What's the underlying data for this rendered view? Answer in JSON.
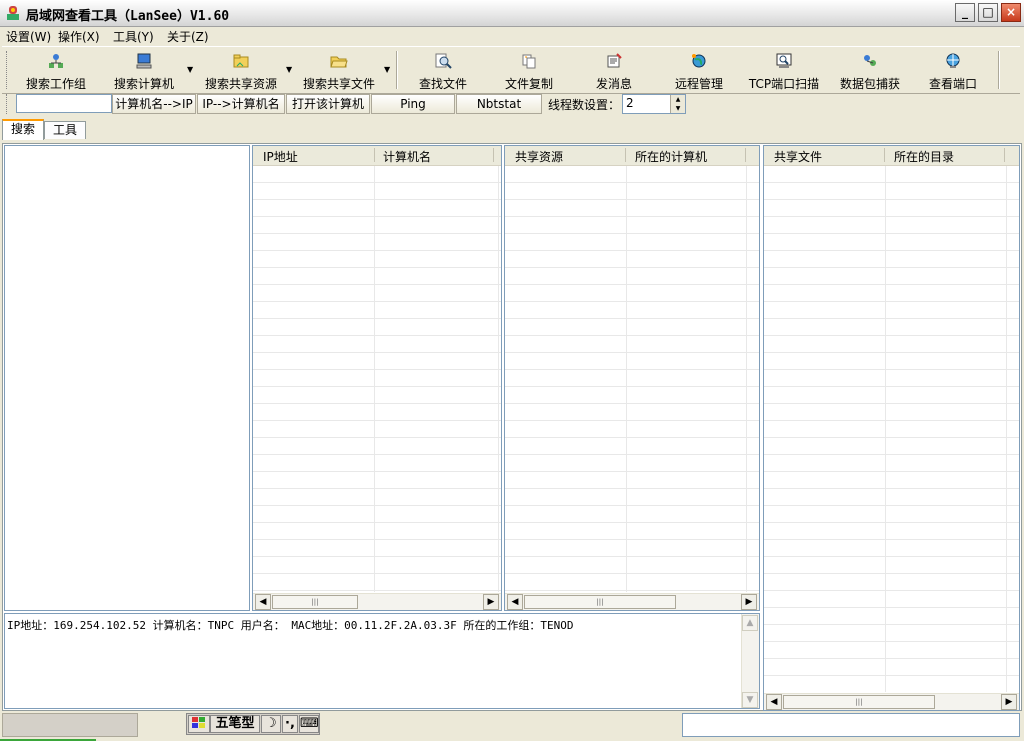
{
  "window": {
    "title": "局域网查看工具（LanSee）V1.60"
  },
  "menu": [
    "设置(W)",
    "操作(X)",
    "工具(Y)",
    "关于(Z)"
  ],
  "toolbar": {
    "items": [
      "搜索工作组",
      "搜索计算机",
      "搜索共享资源",
      "搜索共享文件",
      "查找文件",
      "文件复制",
      "发消息",
      "远程管理",
      "TCP端口扫描",
      "数据包捕获",
      "查看端口"
    ]
  },
  "toolbar2": {
    "input_value": "",
    "buttons": [
      "计算机名-->IP",
      "IP-->计算机名",
      "打开该计算机",
      "Ping",
      "Nbtstat"
    ],
    "thread_label": "线程数设置：",
    "thread_value": "2"
  },
  "tabs": [
    "搜索",
    "工具"
  ],
  "list1": {
    "columns": [
      "IP地址",
      "计算机名"
    ]
  },
  "list2": {
    "columns": [
      "共享资源",
      "所在的计算机"
    ]
  },
  "list3": {
    "columns": [
      "共享文件",
      "所在的目录"
    ]
  },
  "info_text": "IP地址：169.254.102.52 计算机名：TNPC 用户名： MAC地址：00.11.2F.2A.03.3F 所在的工作组：TENOD",
  "ime": {
    "mode": "五笔型"
  },
  "icons": {
    "app": "lansee-app-icon",
    "scroll_left": "◀",
    "scroll_right": "▶",
    "scroll_up": "▲",
    "scroll_down": "▼",
    "thumb_grip": "|||"
  }
}
